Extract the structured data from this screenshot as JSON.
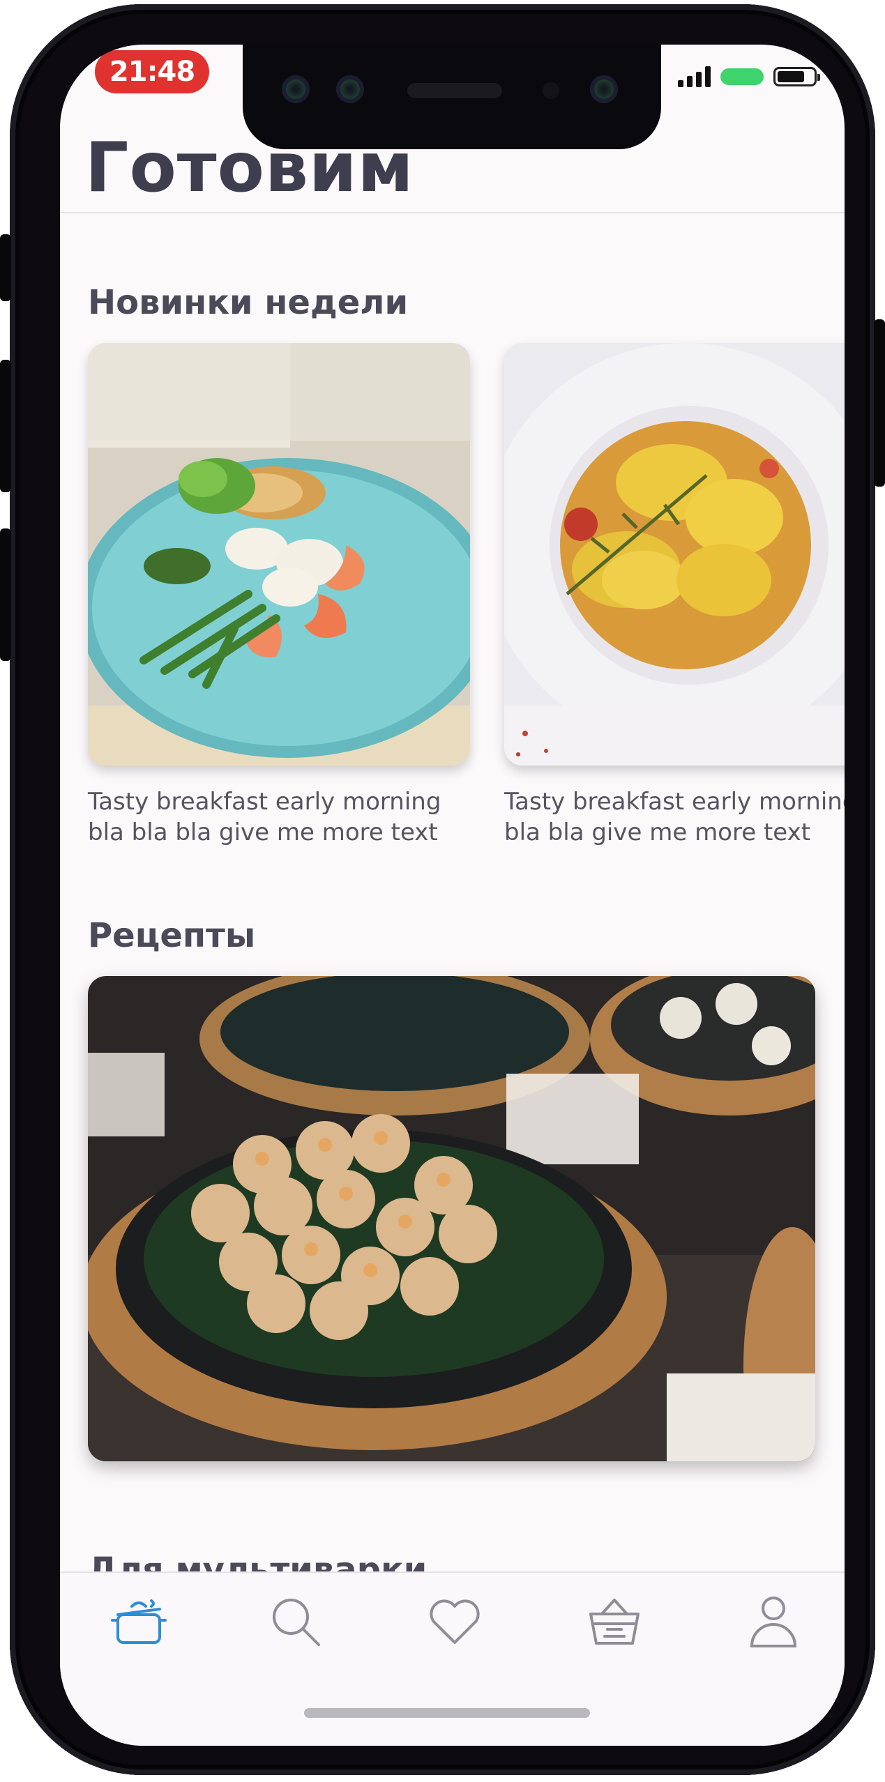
{
  "status_bar": {
    "time": "21:48"
  },
  "header": {
    "title": "Готовим"
  },
  "sections": {
    "new_week": {
      "title": "Новинки недели",
      "cards": [
        {
          "caption": "Tasty breakfast early morning bla bla bla give me more text"
        },
        {
          "caption": "Tasty breakfast early morning bla bla bla give me more text"
        }
      ]
    },
    "recipes": {
      "title": "Рецепты"
    },
    "multicooker": {
      "title": "Для мультиварки"
    }
  },
  "tabbar": {
    "accent_color": "#2a8fd6",
    "inactive_color": "#8f8d96",
    "items": [
      {
        "icon": "pot-icon",
        "active": true
      },
      {
        "icon": "search-icon",
        "active": false
      },
      {
        "icon": "heart-icon",
        "active": false
      },
      {
        "icon": "basket-icon",
        "active": false
      },
      {
        "icon": "profile-icon",
        "active": false
      }
    ]
  }
}
